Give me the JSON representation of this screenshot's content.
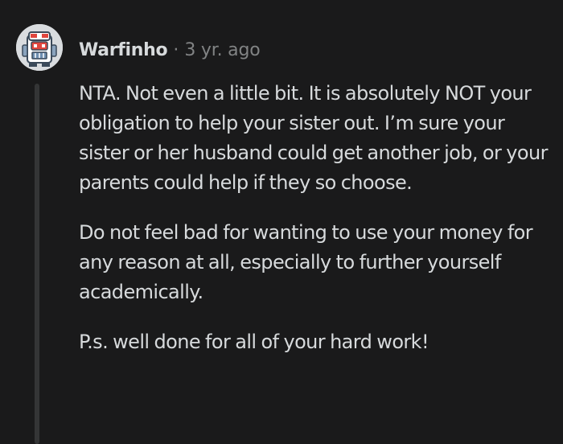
{
  "comment": {
    "author": "Warfinho",
    "separator": "·",
    "timestamp": "3 yr. ago",
    "avatar_icon": "robot-avatar-icon",
    "paragraphs": [
      "NTA. Not even a little bit. It is absolutely NOT your obligation to help your sister out. I’m sure your sister or her husband could get another job, or your parents could help if they so choose.",
      "Do not feel bad for wanting to use your money for any reason at all, especially to further yourself academically.",
      "P.s. well done for all of your hard work!"
    ]
  },
  "colors": {
    "background": "#1a1a1b",
    "text": "#d7dadc",
    "muted": "#818384",
    "thread_line": "#343536"
  }
}
